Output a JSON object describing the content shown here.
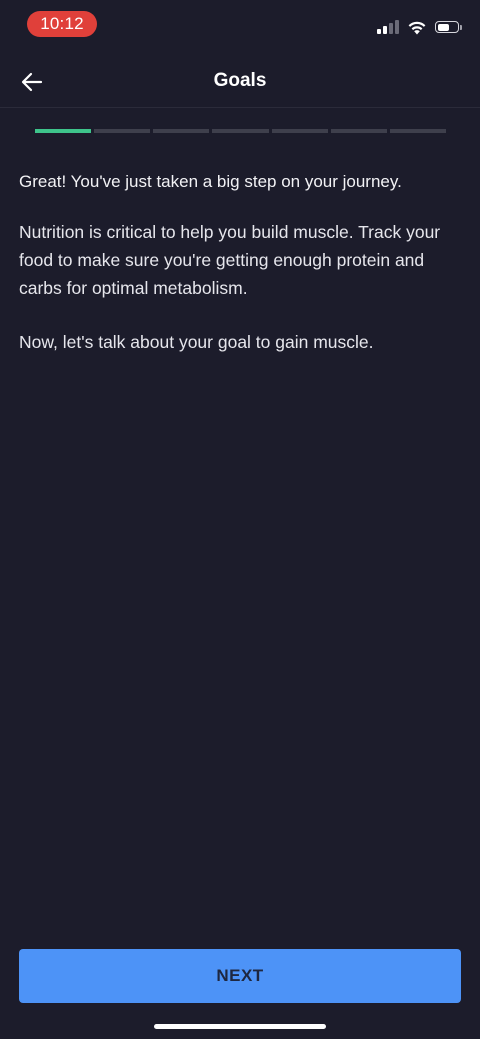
{
  "status_bar": {
    "time": "10:12",
    "signal_bars_filled": 2,
    "signal_bars_total": 4,
    "battery_level": 0.55,
    "time_pill_color": "#e0403a"
  },
  "header": {
    "title": "Goals",
    "back_icon": "arrow-left-icon"
  },
  "progress": {
    "current_step": 1,
    "total_steps": 7,
    "active_color": "#3ec48b",
    "inactive_color": "#3e3f4c"
  },
  "content": {
    "lead": "Great! You've just taken a big step on your journey.",
    "paragraph_1": "Nutrition is critical to help you build muscle. Track your food to make sure you're getting enough protein and carbs for optimal metabolism.",
    "paragraph_2": "Now, let's talk about your goal to gain muscle."
  },
  "footer": {
    "next_label": "NEXT",
    "button_color": "#4d93f7"
  }
}
